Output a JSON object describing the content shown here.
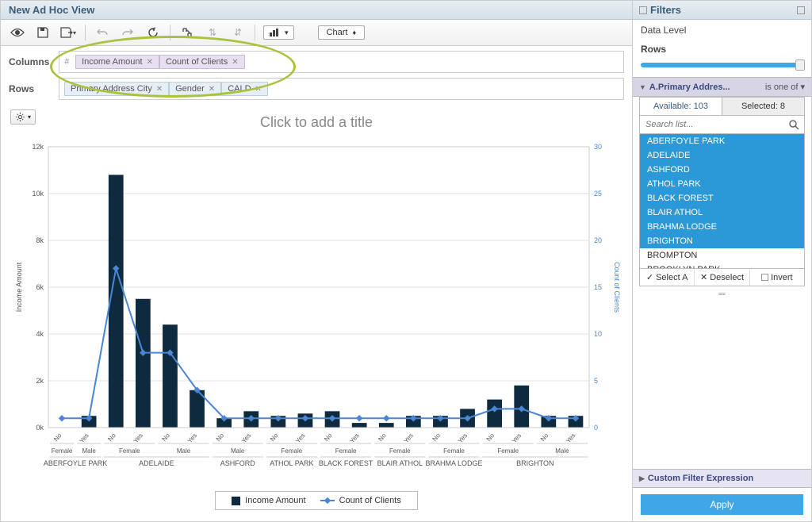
{
  "header": {
    "title": "New Ad Hoc View"
  },
  "toolbar": {
    "chart_dropdown": "Chart"
  },
  "fields": {
    "columns_label": "Columns",
    "rows_label": "Rows",
    "hash": "#",
    "columns": [
      "Income Amount",
      "Count of Clients"
    ],
    "rows": [
      "Primary Address City",
      "Gender",
      "CALD"
    ]
  },
  "chart": {
    "title_placeholder": "Click to add a title",
    "y_left_label": "Income Amount",
    "y_right_label": "Count of Clients",
    "legend": {
      "bar": "Income Amount",
      "line": "Count of Clients"
    }
  },
  "sidebar": {
    "title": "Filters",
    "data_level": "Data Level",
    "rows_label": "Rows",
    "filter": {
      "name": "A.Primary Addres...",
      "cond": "is one of",
      "tab_available": "Available: 103",
      "tab_selected": "Selected: 8",
      "search_placeholder": "Search list...",
      "items": [
        {
          "label": "ABERFOYLE PARK",
          "sel": true
        },
        {
          "label": "ADELAIDE",
          "sel": true
        },
        {
          "label": "ASHFORD",
          "sel": true
        },
        {
          "label": "ATHOL PARK",
          "sel": true
        },
        {
          "label": "BLACK FOREST",
          "sel": true
        },
        {
          "label": "BLAIR ATHOL",
          "sel": true
        },
        {
          "label": "BRAHMA LODGE",
          "sel": true
        },
        {
          "label": "BRIGHTON",
          "sel": true
        },
        {
          "label": "BROMPTON",
          "sel": false
        },
        {
          "label": "BROOKLYN PARK",
          "sel": false
        }
      ],
      "select_all": "Select A",
      "deselect": "Deselect",
      "invert": "Invert"
    },
    "cfe": "Custom Filter Expression",
    "apply": "Apply"
  },
  "chart_data": {
    "type": "bar",
    "y_left": {
      "label": "Income Amount",
      "ticks": [
        0,
        2000,
        4000,
        6000,
        8000,
        10000,
        12000
      ],
      "tick_labels": [
        "0k",
        "2k",
        "4k",
        "6k",
        "8k",
        "10k",
        "12k"
      ],
      "max": 12000
    },
    "y_right": {
      "label": "Count of Clients",
      "ticks": [
        0,
        5,
        10,
        15,
        20,
        25,
        30
      ],
      "max": 30
    },
    "groups": [
      {
        "city": "ABERFOYLE PARK",
        "genders": [
          {
            "g": "Female",
            "sub": [
              {
                "c": "No",
                "bar": 0,
                "line": 1
              }
            ]
          },
          {
            "g": "Male",
            "sub": [
              {
                "c": "Yes",
                "bar": 500,
                "line": 1
              }
            ]
          }
        ]
      },
      {
        "city": "ADELAIDE",
        "genders": [
          {
            "g": "Female",
            "sub": [
              {
                "c": "No",
                "bar": 10800,
                "line": 17
              },
              {
                "c": "Yes",
                "bar": 5500,
                "line": 8
              }
            ]
          },
          {
            "g": "Male",
            "sub": [
              {
                "c": "No",
                "bar": 4400,
                "line": 8
              },
              {
                "c": "Yes",
                "bar": 1600,
                "line": 4
              }
            ]
          }
        ]
      },
      {
        "city": "ASHFORD",
        "genders": [
          {
            "g": "Male",
            "sub": [
              {
                "c": "No",
                "bar": 400,
                "line": 1
              },
              {
                "c": "Yes",
                "bar": 700,
                "line": 1
              }
            ]
          }
        ]
      },
      {
        "city": "ATHOL PARK",
        "genders": [
          {
            "g": "Female",
            "sub": [
              {
                "c": "No",
                "bar": 500,
                "line": 1
              },
              {
                "c": "Yes",
                "bar": 600,
                "line": 1
              }
            ]
          }
        ]
      },
      {
        "city": "BLACK FOREST",
        "genders": [
          {
            "g": "Female",
            "sub": [
              {
                "c": "No",
                "bar": 700,
                "line": 1
              },
              {
                "c": "Yes",
                "bar": 200,
                "line": 1
              }
            ]
          }
        ]
      },
      {
        "city": "BLAIR ATHOL",
        "genders": [
          {
            "g": "Female",
            "sub": [
              {
                "c": "No",
                "bar": 200,
                "line": 1
              },
              {
                "c": "Yes",
                "bar": 500,
                "line": 1
              }
            ]
          }
        ]
      },
      {
        "city": "BRAHMA LODGE",
        "genders": [
          {
            "g": "Female",
            "sub": [
              {
                "c": "No",
                "bar": 500,
                "line": 1
              },
              {
                "c": "Yes",
                "bar": 800,
                "line": 1
              }
            ]
          }
        ]
      },
      {
        "city": "BRIGHTON",
        "genders": [
          {
            "g": "Female",
            "sub": [
              {
                "c": "No",
                "bar": 1200,
                "line": 2
              },
              {
                "c": "Yes",
                "bar": 1800,
                "line": 2
              }
            ]
          },
          {
            "g": "Male",
            "sub": [
              {
                "c": "No",
                "bar": 500,
                "line": 1
              },
              {
                "c": "Yes",
                "bar": 500,
                "line": 1
              }
            ]
          }
        ]
      }
    ]
  }
}
